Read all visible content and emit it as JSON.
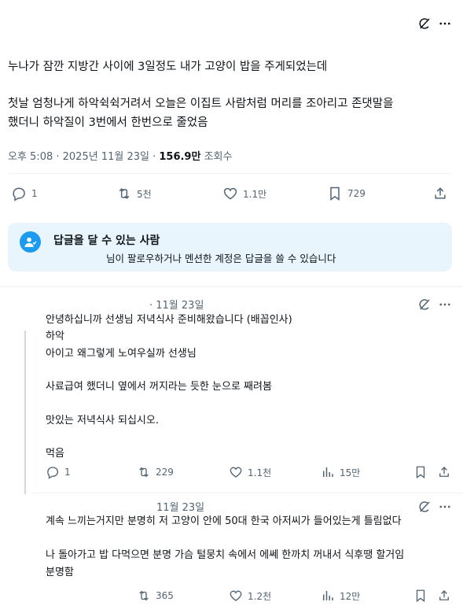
{
  "main_post": {
    "paragraph1": "누나가 잠깐 지방간 사이에 3일정도 내가 고양이 밥을 주게되었는데",
    "paragraph2_line1": "첫날 엄청나게 하악쉭쉭거려서 오늘은 이집트 사람처럼 머리를 조아리고 존댓말을",
    "paragraph2_line2": "했더니 하악질이 3번에서 한번으로 줄었음",
    "time": "오후 5:08 · 2025년 11월 23일 · ",
    "views_count": "156.9만",
    "views_label": " 조회수",
    "replies": "1",
    "reposts": "5천",
    "likes": "1.1만",
    "bookmarks": "729"
  },
  "reply_restriction": {
    "title": "답글을 달 수 있는 사람",
    "description": "님이 팔로우하거나 멘션한 계정은 답글을 쓸 수 있습니다"
  },
  "reply1": {
    "date": "· 11월 23일",
    "lines": [
      "안녕하십니까 선생님 저녁식사 준비해왔습니다 (배꼽인사)",
      "하악",
      "아이고 왜그렇게 노여우실까 선생님",
      "",
      "사료급여 했더니 옆에서 꺼지라는 듯한 눈으로 째려봄",
      "",
      "맛있는 저녁식사 되십시오.",
      "",
      "먹음"
    ],
    "replies": "1",
    "reposts": "229",
    "likes": "1.1천",
    "views": "15만"
  },
  "reply2": {
    "date": "11월 23일",
    "lines": [
      "계속 느끼는거지만 분명히 저 고양이 안에 50대 한국 아저씨가 들어있는게 틀림없다",
      "",
      "나 돌아가고 밥 다먹으면 분명 가슴 털뭉치 속에서 에쎄 한까치 꺼내서 식후땡 할거임",
      "분명함"
    ],
    "reposts": "365",
    "likes": "1.2천",
    "views": "12만"
  },
  "colors": {
    "text": "#0f1419",
    "secondary": "#536471",
    "accent": "#1d9bf0",
    "banner_bg": "#e8f5fd",
    "divider": "#eff3f4"
  }
}
